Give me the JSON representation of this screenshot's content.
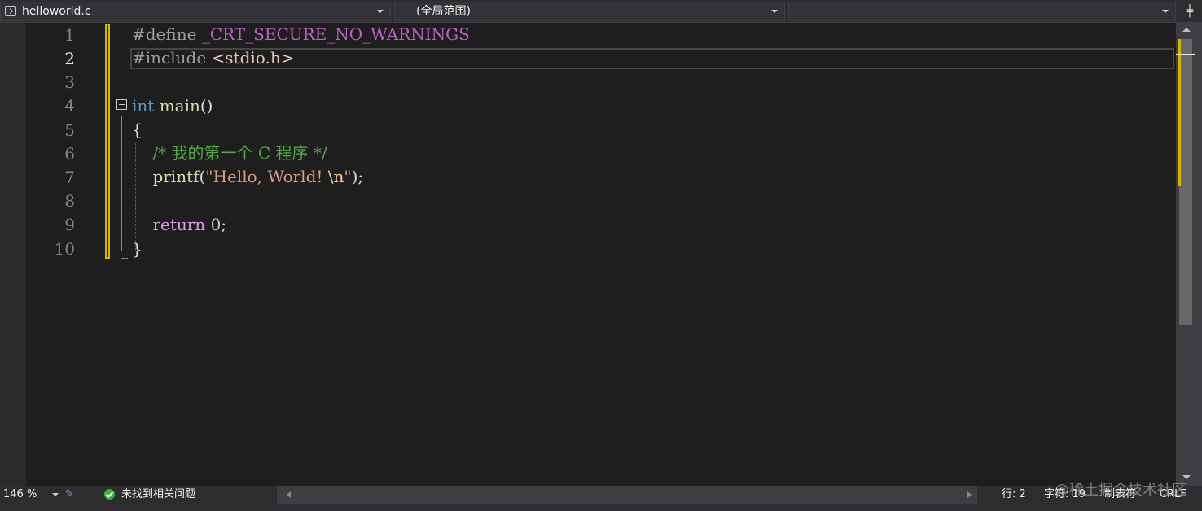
{
  "navbar": {
    "file_dropdown": "helloworld.c",
    "scope_dropdown": "(全局范围)",
    "member_dropdown": ""
  },
  "line_numbers": [
    "1",
    "2",
    "3",
    "4",
    "5",
    "6",
    "7",
    "8",
    "9",
    "10"
  ],
  "code": {
    "l1_directive": "#define",
    "l1_macro": "_CRT_SECURE_NO_WARNINGS",
    "l2_directive": "#include",
    "l2_header": "<stdio.h>",
    "l4_type": "int",
    "l4_func": "main",
    "l4_parens": "()",
    "l5_brace": "{",
    "l6_comment": "/* 我的第一个 C 程序 */",
    "l7_func": "printf",
    "l7_open": "(",
    "l7_str": "\"Hello, World! ",
    "l7_esc": "\\n",
    "l7_strend": "\"",
    "l7_close": ");",
    "l9_keyword": "return",
    "l9_num": "0",
    "l9_semi": ";",
    "l10_brace": "}"
  },
  "statusbar": {
    "zoom": "146 %",
    "issues": "未找到相关问题",
    "line": "行: 2",
    "char": "字符: 19",
    "spaces": "制表符",
    "eol": "CRLF"
  },
  "watermark": "@稀土掘金技术社区",
  "colors": {
    "editor_bg": "#1e1e1e",
    "change_marker": "#d7b400",
    "keyword": "#569cd6",
    "comment": "#57a64a",
    "string": "#d69d85"
  }
}
